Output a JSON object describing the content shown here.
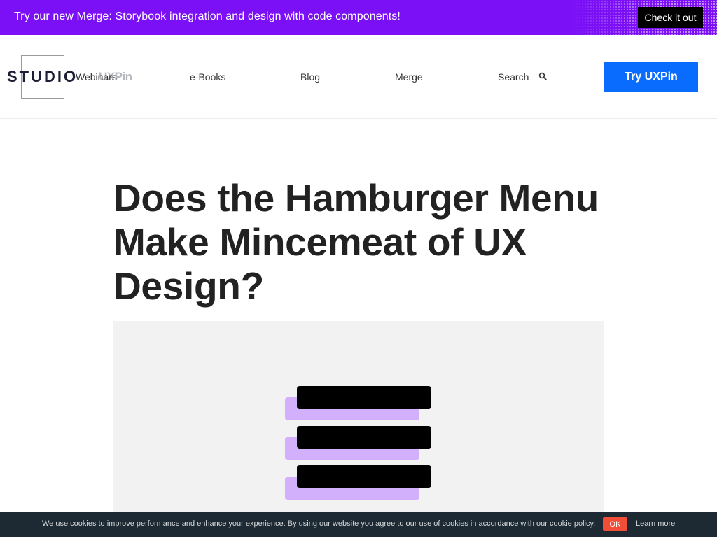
{
  "promo": {
    "text": "Try our new Merge: Storybook integration and design with code components!",
    "cta": "Check it out"
  },
  "header": {
    "logo_text": "STUDIO",
    "logo_brand": "UXPin",
    "nav": [
      "Webinars",
      "e-Books",
      "Blog",
      "Merge"
    ],
    "search_label": "Search",
    "try_button": "Try UXPin"
  },
  "article": {
    "title": "Does the Hamburger Menu Make Mincemeat of UX Design?"
  },
  "cookie": {
    "text": "We use cookies to improve performance and enhance your experience. By using our website you agree to our use of cookies in accordance with our cookie policy.",
    "ok": "OK",
    "learn_more": "Learn more"
  },
  "colors": {
    "promo_bg": "#7b0ff5",
    "primary_button": "#0a6cff",
    "hero_bg": "#f2f2f2",
    "hamburger_shadow": "#d3b0fb",
    "cookie_bg": "#1d2a33",
    "cookie_ok": "#f04e37"
  },
  "icons": {
    "search": "search-icon",
    "hero": "hamburger-menu-icon"
  }
}
